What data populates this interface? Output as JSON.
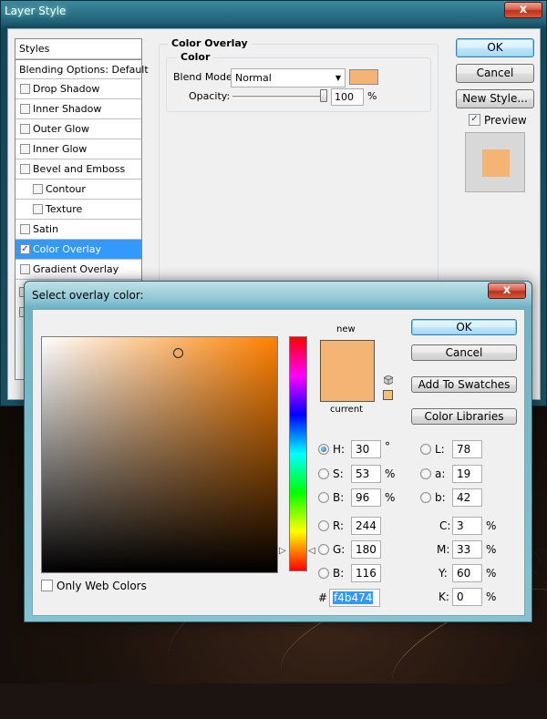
{
  "layer_style": {
    "title": "Layer Style",
    "close_glyph": "x",
    "styles_header": "Styles",
    "items": [
      {
        "label": "Blending Options: Default",
        "checkbox": false,
        "indent": false,
        "checked": false,
        "selected": false
      },
      {
        "label": "Drop Shadow",
        "checkbox": true,
        "indent": false,
        "checked": false,
        "selected": false
      },
      {
        "label": "Inner Shadow",
        "checkbox": true,
        "indent": false,
        "checked": false,
        "selected": false
      },
      {
        "label": "Outer Glow",
        "checkbox": true,
        "indent": false,
        "checked": false,
        "selected": false
      },
      {
        "label": "Inner Glow",
        "checkbox": true,
        "indent": false,
        "checked": false,
        "selected": false
      },
      {
        "label": "Bevel and Emboss",
        "checkbox": true,
        "indent": false,
        "checked": false,
        "selected": false
      },
      {
        "label": "Contour",
        "checkbox": true,
        "indent": true,
        "checked": false,
        "selected": false
      },
      {
        "label": "Texture",
        "checkbox": true,
        "indent": true,
        "checked": false,
        "selected": false
      },
      {
        "label": "Satin",
        "checkbox": true,
        "indent": false,
        "checked": false,
        "selected": false
      },
      {
        "label": "Color Overlay",
        "checkbox": true,
        "indent": false,
        "checked": true,
        "selected": true
      },
      {
        "label": "Gradient Overlay",
        "checkbox": true,
        "indent": false,
        "checked": false,
        "selected": false
      }
    ],
    "panel_title": "Color Overlay",
    "subgroup_title": "Color",
    "blend_mode_label": "Blend Mode:",
    "blend_mode_value": "Normal",
    "opacity_label": "Opacity:",
    "opacity_value": "100",
    "opacity_unit": "%",
    "opacity_fraction": 1.0,
    "overlay_color": "#f4b474",
    "ok": "OK",
    "cancel": "Cancel",
    "new_style": "New Style...",
    "preview_label": "Preview",
    "preview_checked": true
  },
  "picker": {
    "title": "Select overlay color:",
    "close_glyph": "x",
    "new_label": "new",
    "current_label": "current",
    "ok": "OK",
    "cancel": "Cancel",
    "add_to_swatches": "Add To Swatches",
    "color_libraries": "Color Libraries",
    "only_web_colors": "Only Web Colors",
    "fields": {
      "H": {
        "label": "H:",
        "value": "30",
        "unit": "°"
      },
      "S": {
        "label": "S:",
        "value": "53",
        "unit": "%"
      },
      "B": {
        "label": "B:",
        "value": "96",
        "unit": "%"
      },
      "R": {
        "label": "R:",
        "value": "244"
      },
      "G": {
        "label": "G:",
        "value": "180"
      },
      "Bl": {
        "label": "B:",
        "value": "116"
      },
      "L": {
        "label": "L:",
        "value": "78"
      },
      "a": {
        "label": "a:",
        "value": "19"
      },
      "b": {
        "label": "b:",
        "value": "42"
      },
      "C": {
        "label": "C:",
        "value": "3",
        "unit": "%"
      },
      "M": {
        "label": "M:",
        "value": "33",
        "unit": "%"
      },
      "Y": {
        "label": "Y:",
        "value": "60",
        "unit": "%"
      },
      "K": {
        "label": "K:",
        "value": "0",
        "unit": "%"
      }
    },
    "hex_prefix": "#",
    "hex_value": "f4b474",
    "new_color": "#f4b474",
    "current_color": "#f4b474",
    "hue_base_color": "#ff8000"
  }
}
